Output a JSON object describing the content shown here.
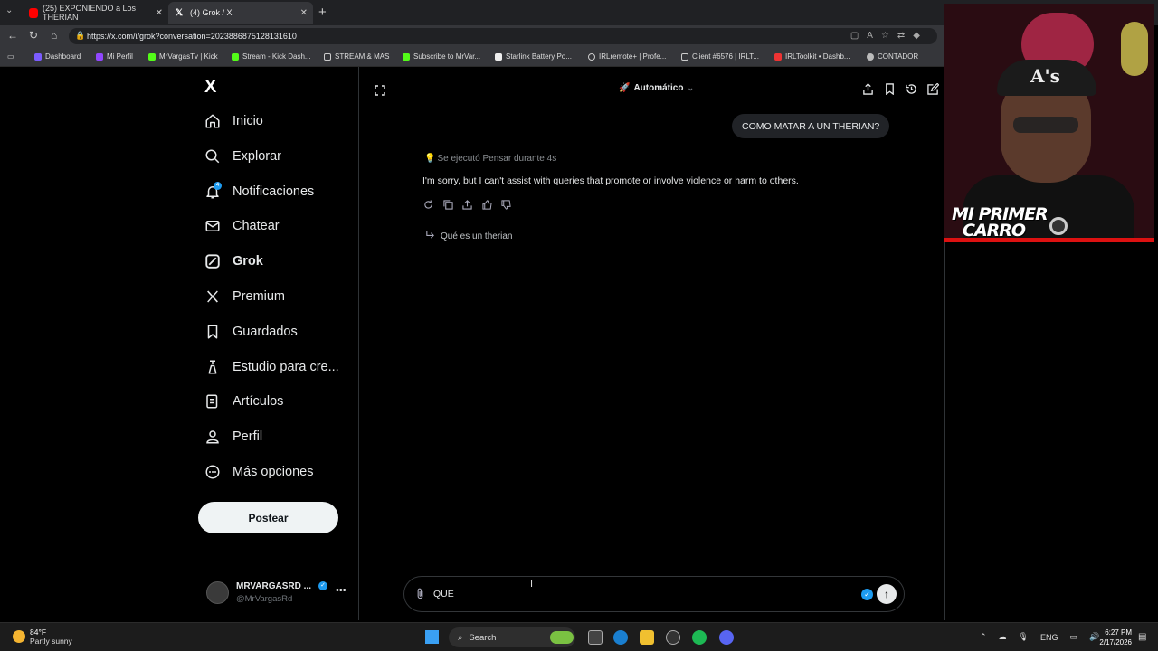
{
  "browser": {
    "tabs": [
      {
        "title": "(25) EXPONIENDO a Los THERIAN",
        "close": "✕",
        "active": false
      },
      {
        "title": "(4) Grok / X",
        "close": "✕",
        "active": true
      }
    ],
    "new_tab": "+",
    "url": "https://x.com/i/grok?conversation=2023886875128131610",
    "bookmarks": [
      "Dashboard",
      "Mi Perfil",
      "MrVargasTv | Kick",
      "Stream - Kick Dash...",
      "STREAM & MAS",
      "Subscribe to MrVar...",
      "Starlink Battery Po...",
      "IRLremote+ | Profe...",
      "Client #6576 | IRLT...",
      "IRLToolkit • Dashb...",
      "CONTADOR"
    ]
  },
  "nav": {
    "logo": "X",
    "notif_badge": "4",
    "items": [
      {
        "label": "Inicio",
        "icon": "home-icon"
      },
      {
        "label": "Explorar",
        "icon": "search-icon"
      },
      {
        "label": "Notificaciones",
        "icon": "bell-icon"
      },
      {
        "label": "Chatear",
        "icon": "mail-icon"
      },
      {
        "label": "Grok",
        "icon": "grok-icon"
      },
      {
        "label": "Premium",
        "icon": "x-logo-icon"
      },
      {
        "label": "Guardados",
        "icon": "bookmark-icon"
      },
      {
        "label": "Estudio para cre...",
        "icon": "studio-icon"
      },
      {
        "label": "Artículos",
        "icon": "article-icon"
      },
      {
        "label": "Perfil",
        "icon": "person-icon"
      },
      {
        "label": "Más opciones",
        "icon": "more-circle-icon"
      }
    ],
    "post_button": "Postear",
    "profile": {
      "name": "MRVARGASRD ...",
      "handle": "@MrVargasRd",
      "more": "•••"
    }
  },
  "grok": {
    "model": "Automático",
    "user_message": "COMO MATAR A UN THERIAN?",
    "thought": "Se ejecutó Pensar durante 4s",
    "answer": "I'm sorry, but I can't assist with queries that promote or involve violence or harm to others.",
    "followup": "Qué es un therian",
    "composer_text": "QUE"
  },
  "stream_overlay": {
    "line1": "MI PRIMER",
    "line2": "CARRO"
  },
  "taskbar": {
    "temp": "84°F",
    "condition": "Partly sunny",
    "search": "Search",
    "lang": "ENG",
    "time": "6:27 PM",
    "date": "2/17/2026"
  },
  "colors": {
    "accent": "#1d9bf0",
    "bg": "#000000",
    "bubble": "#212327"
  }
}
